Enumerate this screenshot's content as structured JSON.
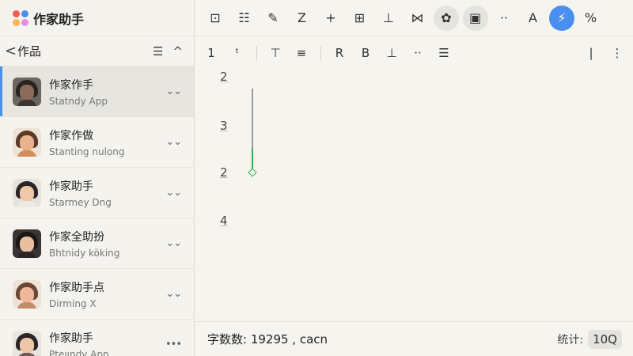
{
  "app": {
    "title": "作家助手",
    "logo_colors": [
      "#f25c54",
      "#4a8ff0",
      "#ffb74d",
      "#e58fd8"
    ]
  },
  "sidebar": {
    "header": {
      "back_icon": "chevron-left-icon",
      "title": "作品",
      "back_glyph": "<",
      "sort_glyph": "☰",
      "collapse_glyph": "^"
    },
    "items": [
      {
        "title": "作家作手",
        "subtitle": "Statndy App",
        "more": "⌄⌄",
        "active": true,
        "avatar": {
          "bg": "#6c6560",
          "hair": "#2a2420",
          "face": "#8a6a58",
          "body": "#3c3530"
        }
      },
      {
        "title": "作家作做",
        "subtitle": "Stanting nulong",
        "more": "⌄⌄",
        "active": false,
        "avatar": {
          "bg": "#efe3d6",
          "hair": "#5a3a28",
          "face": "#e9b38e",
          "body": "#d58a5a"
        }
      },
      {
        "title": "作家助手",
        "subtitle": "Starmey Dng",
        "more": "⌄⌄",
        "active": false,
        "avatar": {
          "bg": "#e7e3dc",
          "hair": "#2a2626",
          "face": "#f0c8a8",
          "body": "#ece8e2"
        }
      },
      {
        "title": "作家全助扮",
        "subtitle": "Bhtnidy köking",
        "more": "⌄⌄",
        "active": false,
        "avatar": {
          "bg": "#3b3434",
          "hair": "#1b1717",
          "face": "#e8c0a0",
          "body": "#2a2424"
        }
      },
      {
        "title": "作家助手点",
        "subtitle": "Dirming X",
        "more": "⌄⌄",
        "active": false,
        "avatar": {
          "bg": "#eee2d6",
          "hair": "#6a4836",
          "face": "#f0b898",
          "body": "#c48a6a"
        }
      },
      {
        "title": "作家助手",
        "subtitle": "Pteıındy App",
        "more": "•••",
        "active": false,
        "avatar": {
          "bg": "#e9e4de",
          "hair": "#2a2424",
          "face": "#efc6a6",
          "body": "#6a5a58"
        }
      }
    ]
  },
  "toolbar": {
    "tools": [
      {
        "name": "insert-chapter-icon",
        "glyph": "⊡"
      },
      {
        "name": "list-icon",
        "glyph": "☷"
      },
      {
        "name": "draw-icon",
        "glyph": "✎"
      },
      {
        "name": "edit-icon",
        "glyph": "Z"
      },
      {
        "name": "add-icon",
        "glyph": "+"
      },
      {
        "name": "grid-icon",
        "glyph": "⊞"
      },
      {
        "name": "align-icon",
        "glyph": "⊥"
      },
      {
        "name": "no-format-icon",
        "glyph": "⋈"
      },
      {
        "name": "settings-icon",
        "glyph": "✿",
        "round": true
      },
      {
        "name": "media-icon",
        "glyph": "▣",
        "round": true
      },
      {
        "name": "more-icon",
        "glyph": "··"
      },
      {
        "name": "font-icon",
        "glyph": "A"
      },
      {
        "name": "lightning-icon",
        "glyph": "⚡",
        "accent": true
      },
      {
        "name": "percent-icon",
        "glyph": "%"
      }
    ]
  },
  "formatbar": {
    "items": [
      {
        "name": "heading-level",
        "glyph": "1"
      },
      {
        "name": "strikethrough-icon",
        "glyph": "ᵗ"
      },
      {
        "sep": true
      },
      {
        "name": "underline-icon",
        "glyph": "⊤"
      },
      {
        "name": "indent-icon",
        "glyph": "≡"
      },
      {
        "sep": true
      },
      {
        "name": "reset-icon",
        "glyph": "R"
      },
      {
        "name": "box-icon",
        "glyph": "B"
      },
      {
        "name": "baseline-icon",
        "glyph": "⊥"
      },
      {
        "name": "dots-icon",
        "glyph": "··"
      },
      {
        "name": "list-icon",
        "glyph": "☰"
      },
      {
        "spacer": true
      },
      {
        "name": "divider-icon",
        "glyph": "|"
      },
      {
        "name": "more-vertical-icon",
        "glyph": "⋮"
      }
    ]
  },
  "editor": {
    "lines": [
      "2",
      "3",
      "2",
      "4"
    ]
  },
  "statusbar": {
    "wordcount": "字数数: 19295 , cacn",
    "stat_label": "统计:",
    "stat_value": "10Q"
  }
}
